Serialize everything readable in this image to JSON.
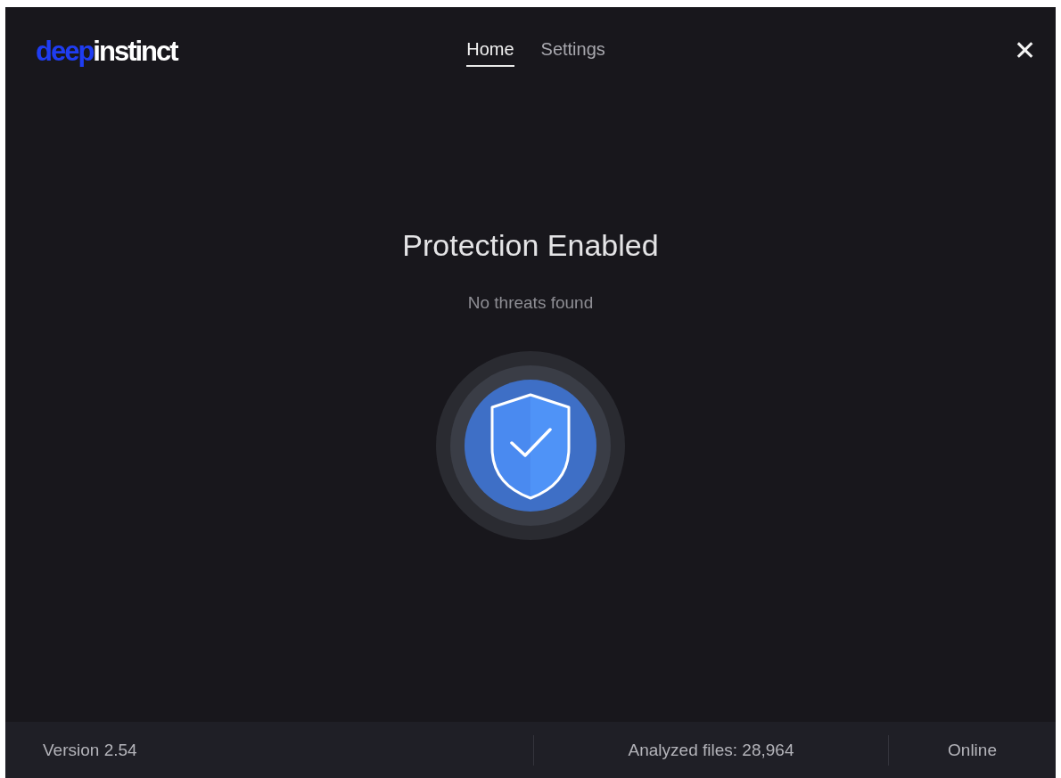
{
  "logo": {
    "prefix": "deep",
    "suffix": "instinct"
  },
  "tabs": [
    {
      "label": "Home",
      "selected": true
    },
    {
      "label": "Settings",
      "selected": false
    }
  ],
  "close": "✕",
  "status": {
    "title": "Protection Enabled",
    "subtitle": "No threats found"
  },
  "footer": [
    "Version 2.54",
    "Analyzed files: 28,964",
    "Online"
  ]
}
